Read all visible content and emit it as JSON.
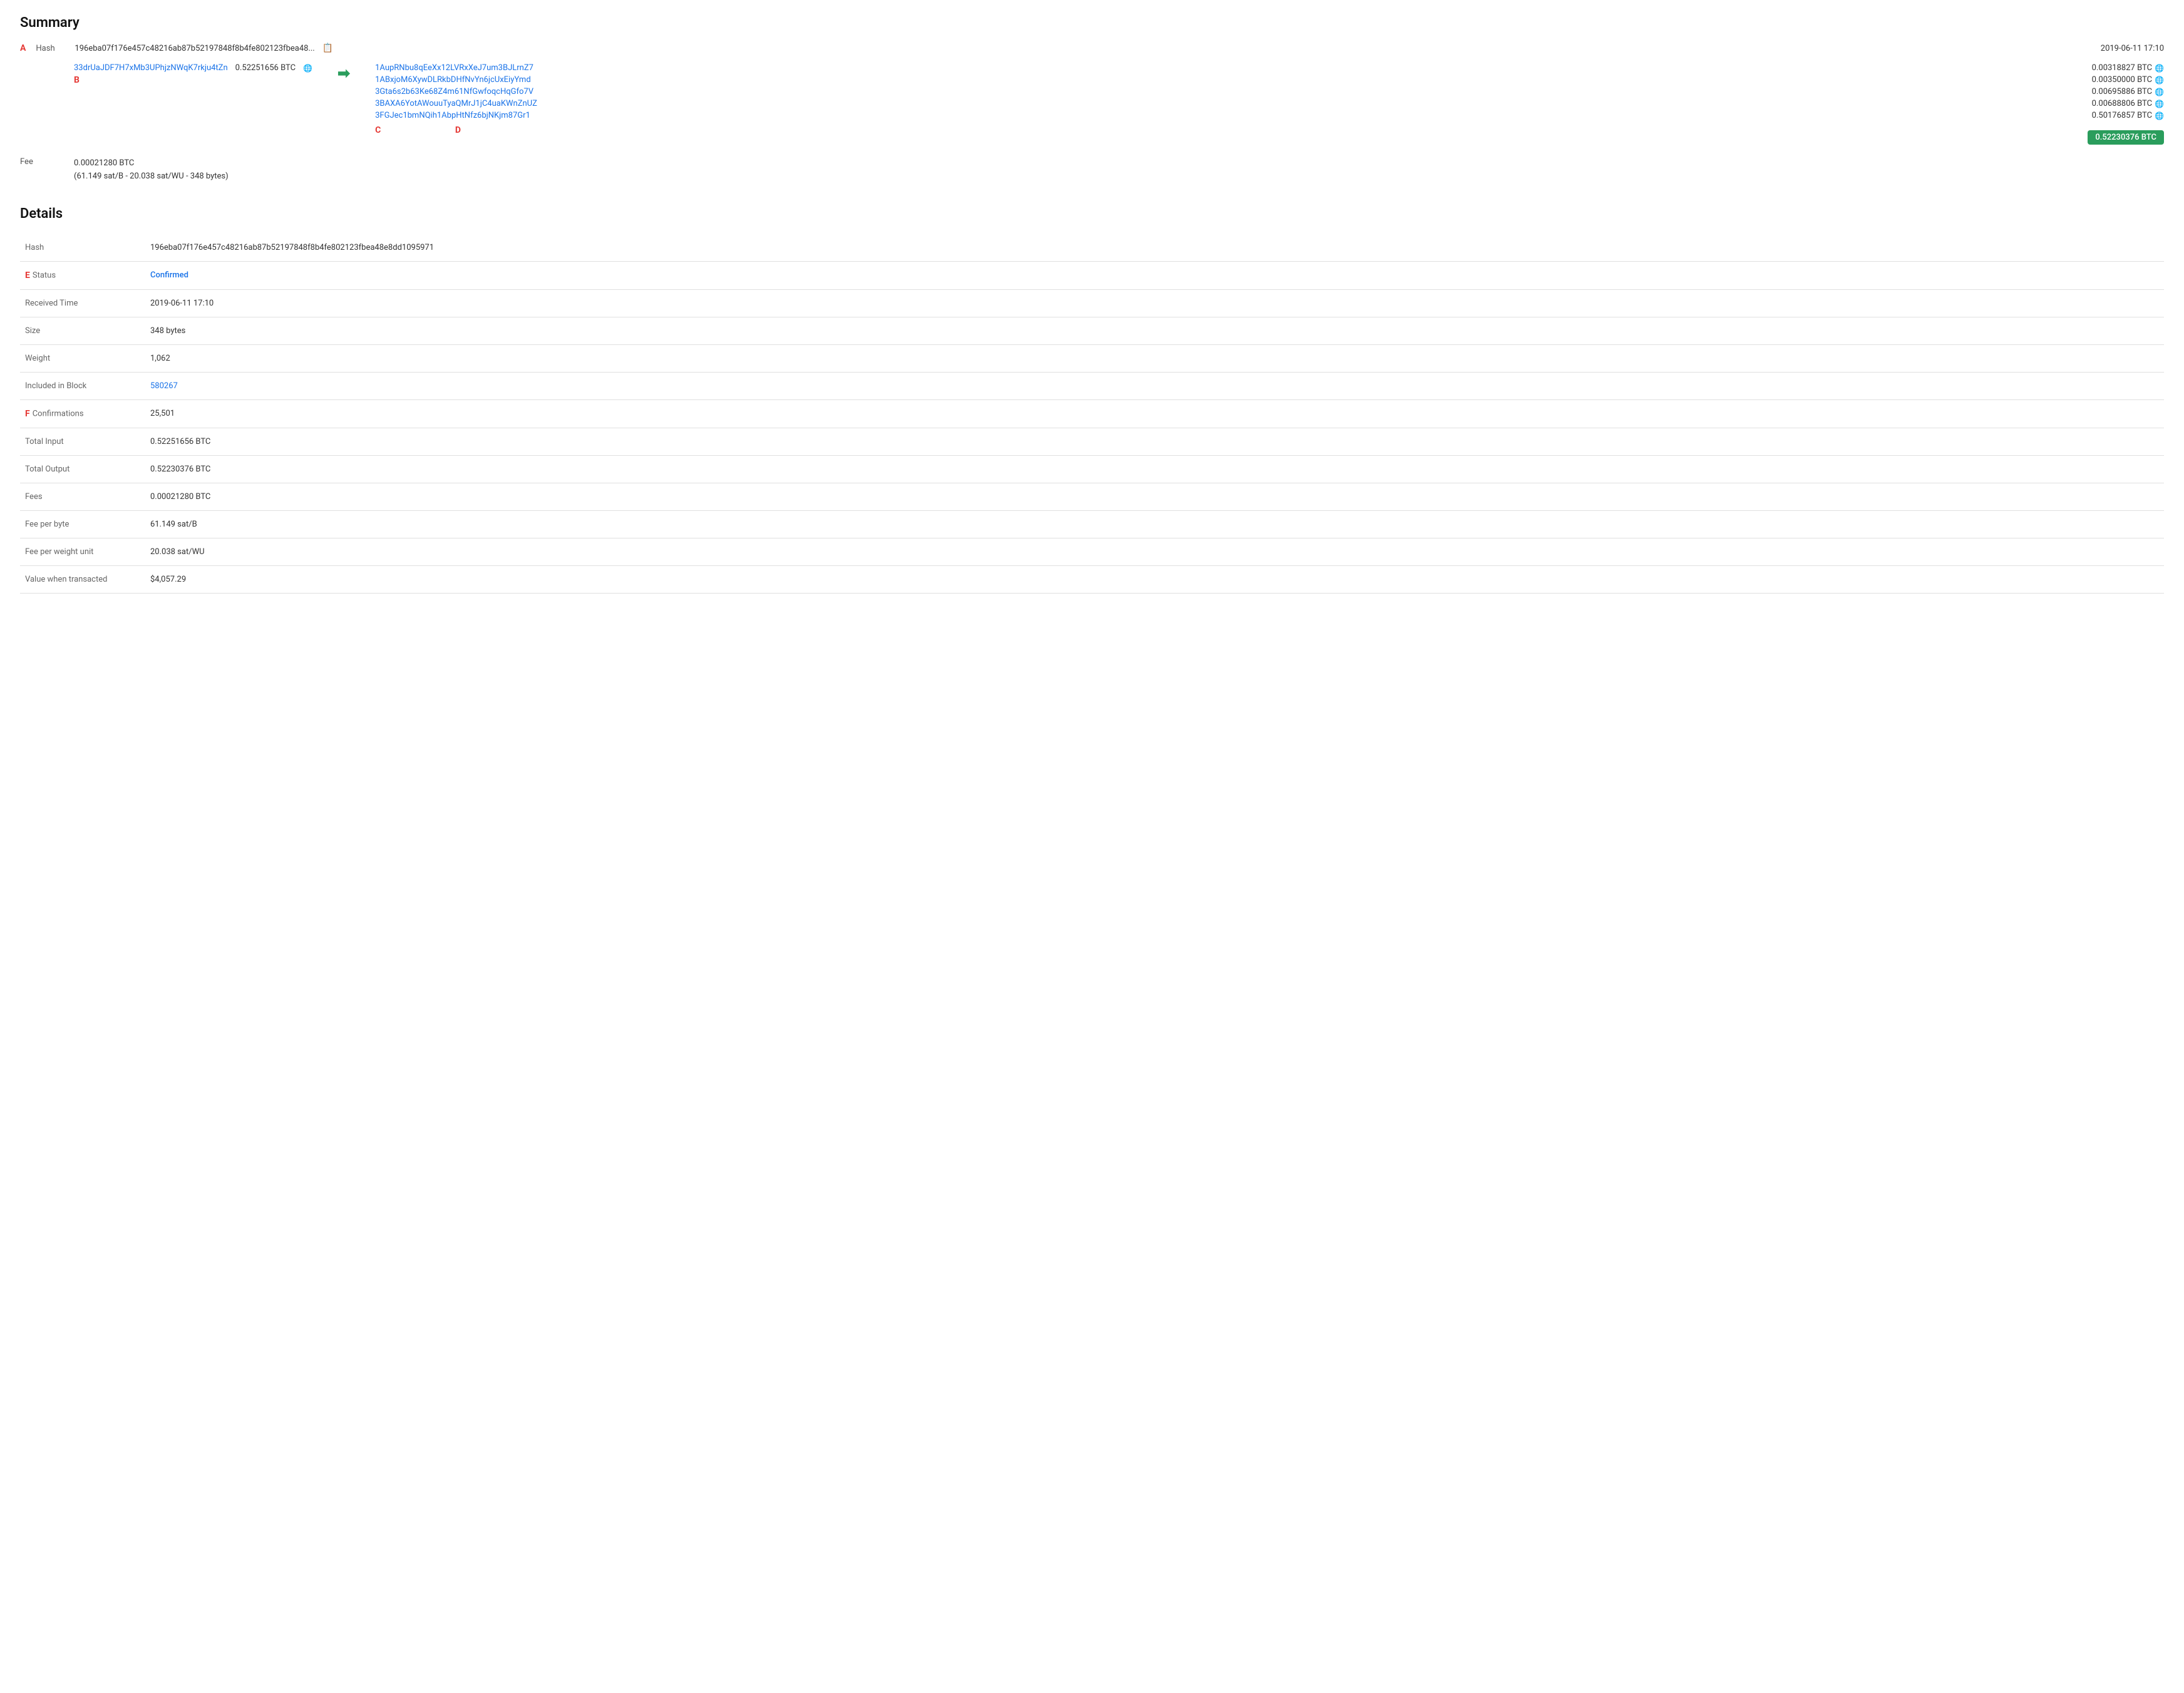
{
  "page": {
    "summary_title": "Summary",
    "details_title": "Details"
  },
  "summary": {
    "hash_label": "Hash",
    "hash_value": "196eba07f176e457c48216ab87b52197848f8b4fe802123fbea48...",
    "date": "2019-06-11 17:10",
    "input_label": "",
    "input_address": "33drUaJDF7H7xMb3UPhjzNWqK7rkju4tZn",
    "input_amount": "0.52251656 BTC",
    "arrow": "→",
    "outputs": [
      {
        "address": "1AupRNbu8qEeXx12LVRxXeJ7um3BJLrnZ7",
        "amount": "0.00318827 BTC"
      },
      {
        "address": "1ABxjoM6XywDLRkbDHfNvYn6jcUxEiyYmd",
        "amount": "0.00350000 BTC"
      },
      {
        "address": "3Gta6s2b63Ke68Z4m61NfGwfoqcHqGfo7V",
        "amount": "0.00695886 BTC"
      },
      {
        "address": "3BAXA6YotAWouuTyaQMrJ1jC4uaKWnZnUZ",
        "amount": "0.00688806 BTC"
      },
      {
        "address": "3FGJec1bmNQih1AbpHtNfz6bjNKjm87Gr1",
        "amount": "0.50176857 BTC"
      }
    ],
    "total_output": "0.52230376 BTC",
    "fee_label": "Fee",
    "fee_main": "0.00021280 BTC",
    "fee_detail": "(61.149 sat/B - 20.038 sat/WU - 348 bytes)"
  },
  "details": {
    "rows": [
      {
        "label": "Hash",
        "value": "196eba07f176e457c48216ab87b52197848f8b4fe802123fbea48e8dd1095971",
        "type": "text"
      },
      {
        "label": "Status",
        "value": "Confirmed",
        "type": "status"
      },
      {
        "label": "Received Time",
        "value": "2019-06-11 17:10",
        "type": "text"
      },
      {
        "label": "Size",
        "value": "348 bytes",
        "type": "text"
      },
      {
        "label": "Weight",
        "value": "1,062",
        "type": "text"
      },
      {
        "label": "Included in Block",
        "value": "580267",
        "type": "link"
      },
      {
        "label": "Confirmations",
        "value": "25,501",
        "type": "text"
      },
      {
        "label": "Total Input",
        "value": "0.52251656 BTC",
        "type": "text"
      },
      {
        "label": "Total Output",
        "value": "0.52230376 BTC",
        "type": "text"
      },
      {
        "label": "Fees",
        "value": "0.00021280 BTC",
        "type": "text"
      },
      {
        "label": "Fee per byte",
        "value": "61.149 sat/B",
        "type": "text"
      },
      {
        "label": "Fee per weight unit",
        "value": "20.038 sat/WU",
        "type": "text"
      },
      {
        "label": "Value when transacted",
        "value": "$4,057.29",
        "type": "text"
      }
    ]
  },
  "annotations": {
    "A": "A",
    "B": "B",
    "C": "C",
    "D": "D",
    "E": "E",
    "F": "F"
  }
}
